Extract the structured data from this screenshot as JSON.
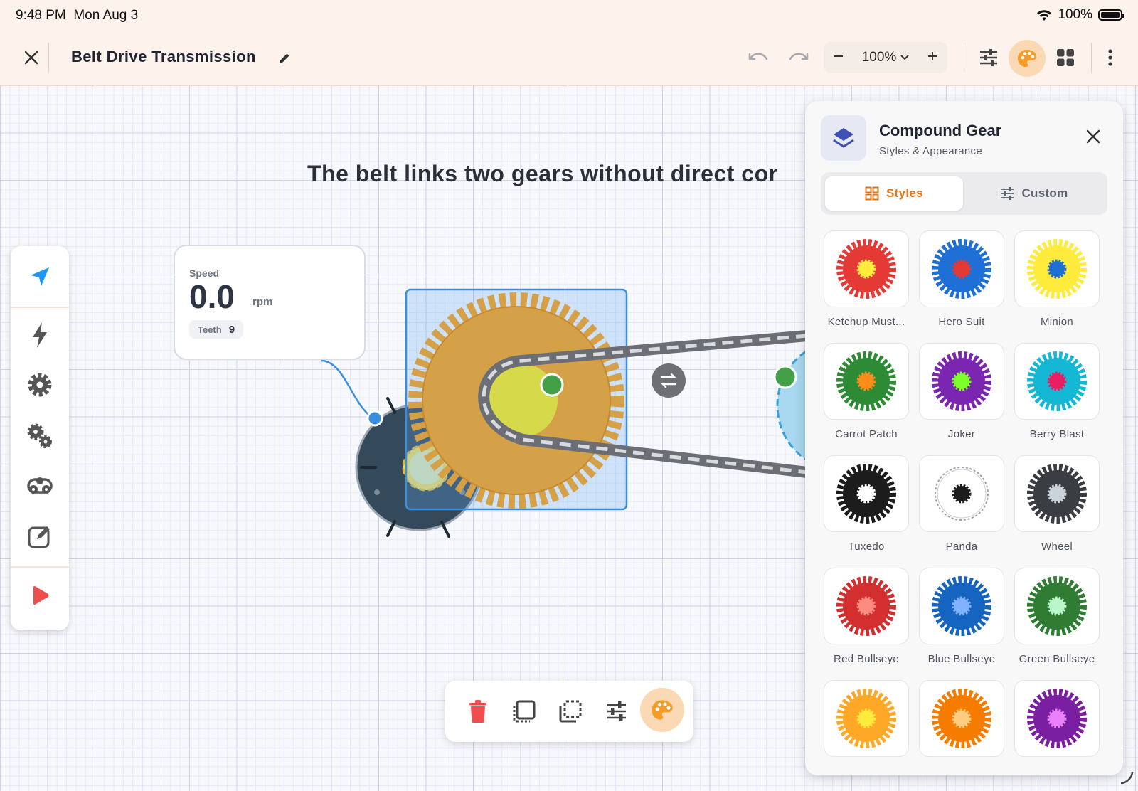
{
  "status": {
    "time": "9:48 PM",
    "date": "Mon Aug 3",
    "battery": "100%"
  },
  "toolbar": {
    "title": "Belt Drive Transmission",
    "zoom": "100%",
    "icons": [
      "close-icon",
      "pencil-icon",
      "undo-icon",
      "redo-icon",
      "minus-icon",
      "plus-icon",
      "sliders-icon",
      "palette-icon",
      "grid-icon",
      "more-icon"
    ]
  },
  "canvas": {
    "title": "The belt links two gears without direct cor",
    "speed_card": {
      "label": "Speed",
      "value": "0.0",
      "unit": "rpm",
      "teeth_label": "Teeth",
      "teeth_value": "9"
    }
  },
  "left_tools": [
    "cursor-icon",
    "bolt-icon",
    "gear-icon",
    "gears-icon",
    "chain-icon",
    "edit-icon",
    "play-icon"
  ],
  "action_bar": [
    "trash-icon",
    "duplicate-icon",
    "select-icon",
    "sliders-icon",
    "palette-icon"
  ],
  "panel": {
    "title": "Compound Gear",
    "subtitle": "Styles & Appearance",
    "tabs": {
      "styles": "Styles",
      "custom": "Custom"
    },
    "styles": [
      {
        "name": "Ketchup Must...",
        "outer": "#e53935",
        "inner": "#ffeb3b"
      },
      {
        "name": "Hero Suit",
        "outer": "#1e6fd6",
        "inner": "#e53935"
      },
      {
        "name": "Minion",
        "outer": "#ffeb3b",
        "inner": "#1e6fd6"
      },
      {
        "name": "Carrot Patch",
        "outer": "#2e8b35",
        "inner": "#ff8c1a"
      },
      {
        "name": "Joker",
        "outer": "#7b26b0",
        "inner": "#7dff2a"
      },
      {
        "name": "Berry Blast",
        "outer": "#14b8d4",
        "inner": "#e91e63"
      },
      {
        "name": "Tuxedo",
        "outer": "#1c1c1c",
        "inner": "#ffffff"
      },
      {
        "name": "Panda",
        "outer": "#ffffff",
        "inner": "#1c1c1c"
      },
      {
        "name": "Wheel",
        "outer": "#3a3d42",
        "inner": "#c9d3d9"
      },
      {
        "name": "Red Bullseye",
        "outer": "#d32f2f",
        "inner": "#ff8a80"
      },
      {
        "name": "Blue Bullseye",
        "outer": "#1565c0",
        "inner": "#82b1ff"
      },
      {
        "name": "Green Bullseye",
        "outer": "#2e7d32",
        "inner": "#b9f6ca"
      },
      {
        "name": "",
        "outer": "#ffa726",
        "inner": "#ffeb3b"
      },
      {
        "name": "",
        "outer": "#f57c00",
        "inner": "#ffcc80"
      },
      {
        "name": "",
        "outer": "#7b1fa2",
        "inner": "#ea80fc"
      }
    ]
  },
  "colors": {
    "accent": "#f39c2a",
    "selection": "#3b8de0",
    "belt": "#6b6e75",
    "gear_gold": "#d4a048"
  }
}
